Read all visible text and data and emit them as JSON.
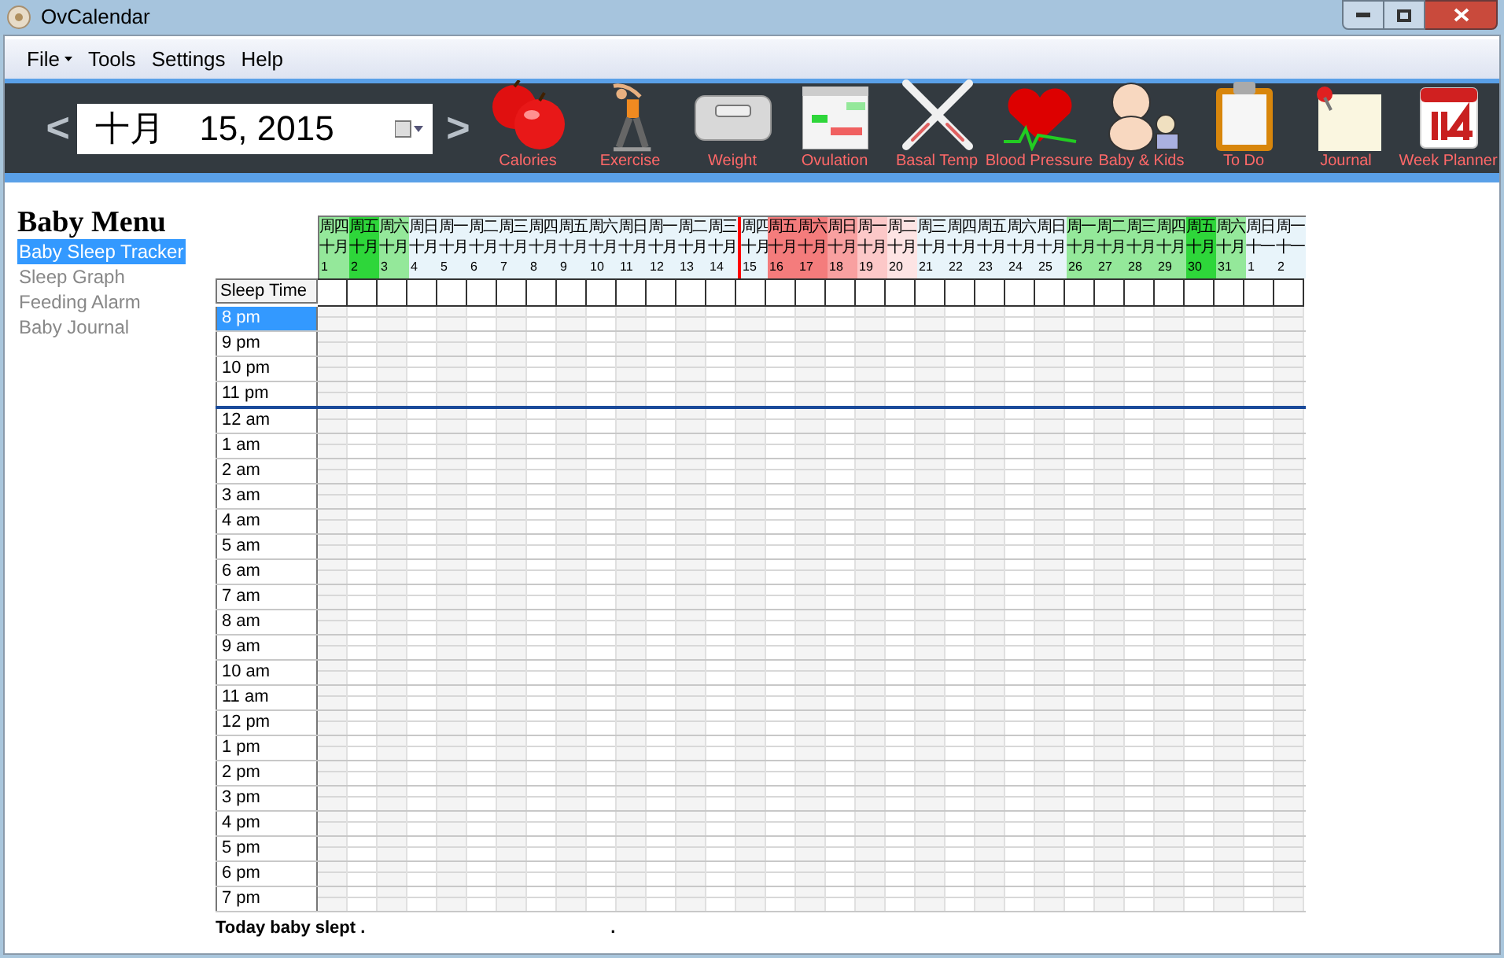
{
  "window": {
    "title": "OvCalendar"
  },
  "menu": [
    {
      "label": "File",
      "has_dropdown": true
    },
    {
      "label": "Tools",
      "has_dropdown": false
    },
    {
      "label": "Settings",
      "has_dropdown": false
    },
    {
      "label": "Help",
      "has_dropdown": false
    }
  ],
  "date_nav": {
    "prev": "<",
    "next": ">",
    "date_value": "十月　15, 2015"
  },
  "toolbar": [
    {
      "label": "Calories"
    },
    {
      "label": "Exercise"
    },
    {
      "label": "Weight"
    },
    {
      "label": "Ovulation"
    },
    {
      "label": "Basal Temp"
    },
    {
      "label": "Blood Pressure"
    },
    {
      "label": "Baby & Kids"
    },
    {
      "label": "To Do"
    },
    {
      "label": "Journal"
    },
    {
      "label": "Week Planner"
    }
  ],
  "sidebar": {
    "title": "Baby Menu",
    "items": [
      {
        "label": "Baby Sleep Tracker",
        "selected": true
      },
      {
        "label": "Sleep Graph",
        "selected": false
      },
      {
        "label": "Feeding Alarm",
        "selected": false
      },
      {
        "label": "Baby Journal",
        "selected": false
      }
    ]
  },
  "tracker": {
    "corner_label": "Sleep Time",
    "days": [
      {
        "weekday": "周四",
        "month": "十月",
        "day": "1",
        "color": "#94e89a",
        "selected": false
      },
      {
        "weekday": "周五",
        "month": "十月",
        "day": "2",
        "color": "#2ed63a",
        "selected": false
      },
      {
        "weekday": "周六",
        "month": "十月",
        "day": "3",
        "color": "#94e89a",
        "selected": false
      },
      {
        "weekday": "周日",
        "month": "十月",
        "day": "4",
        "color": "#e8f4fa",
        "selected": false
      },
      {
        "weekday": "周一",
        "month": "十月",
        "day": "5",
        "color": "#e8f4fa",
        "selected": false
      },
      {
        "weekday": "周二",
        "month": "十月",
        "day": "6",
        "color": "#e8f4fa",
        "selected": false
      },
      {
        "weekday": "周三",
        "month": "十月",
        "day": "7",
        "color": "#e8f4fa",
        "selected": false
      },
      {
        "weekday": "周四",
        "month": "十月",
        "day": "8",
        "color": "#e8f4fa",
        "selected": false
      },
      {
        "weekday": "周五",
        "month": "十月",
        "day": "9",
        "color": "#e8f4fa",
        "selected": false
      },
      {
        "weekday": "周六",
        "month": "十月",
        "day": "10",
        "color": "#e8f4fa",
        "selected": false
      },
      {
        "weekday": "周日",
        "month": "十月",
        "day": "11",
        "color": "#e8f4fa",
        "selected": false
      },
      {
        "weekday": "周一",
        "month": "十月",
        "day": "12",
        "color": "#e8f4fa",
        "selected": false
      },
      {
        "weekday": "周二",
        "month": "十月",
        "day": "13",
        "color": "#e8f4fa",
        "selected": false
      },
      {
        "weekday": "周三",
        "month": "十月",
        "day": "14",
        "color": "#e8f4fa",
        "selected": false
      },
      {
        "weekday": "周四",
        "month": "十月",
        "day": "15",
        "color": "#e8f4fa",
        "selected": true
      },
      {
        "weekday": "周五",
        "month": "十月",
        "day": "16",
        "color": "#f47c7c",
        "selected": false
      },
      {
        "weekday": "周六",
        "month": "十月",
        "day": "17",
        "color": "#f47c7c",
        "selected": false
      },
      {
        "weekday": "周日",
        "month": "十月",
        "day": "18",
        "color": "#f8a0a0",
        "selected": false
      },
      {
        "weekday": "周一",
        "month": "十月",
        "day": "19",
        "color": "#fcc8c8",
        "selected": false
      },
      {
        "weekday": "周二",
        "month": "十月",
        "day": "20",
        "color": "#fde4e4",
        "selected": false
      },
      {
        "weekday": "周三",
        "month": "十月",
        "day": "21",
        "color": "#e8f4fa",
        "selected": false
      },
      {
        "weekday": "周四",
        "month": "十月",
        "day": "22",
        "color": "#e8f4fa",
        "selected": false
      },
      {
        "weekday": "周五",
        "month": "十月",
        "day": "23",
        "color": "#e8f4fa",
        "selected": false
      },
      {
        "weekday": "周六",
        "month": "十月",
        "day": "24",
        "color": "#e8f4fa",
        "selected": false
      },
      {
        "weekday": "周日",
        "month": "十月",
        "day": "25",
        "color": "#e8f4fa",
        "selected": false
      },
      {
        "weekday": "周一",
        "month": "十月",
        "day": "26",
        "color": "#94e89a",
        "selected": false
      },
      {
        "weekday": "周二",
        "month": "十月",
        "day": "27",
        "color": "#94e89a",
        "selected": false
      },
      {
        "weekday": "周三",
        "month": "十月",
        "day": "28",
        "color": "#94e89a",
        "selected": false
      },
      {
        "weekday": "周四",
        "month": "十月",
        "day": "29",
        "color": "#94e89a",
        "selected": false
      },
      {
        "weekday": "周五",
        "month": "十月",
        "day": "30",
        "color": "#2ed63a",
        "selected": false
      },
      {
        "weekday": "周六",
        "month": "十月",
        "day": "31",
        "color": "#94e89a",
        "selected": false
      },
      {
        "weekday": "周日",
        "month": "十一",
        "day": "1",
        "color": "#e8f4fa",
        "selected": false
      },
      {
        "weekday": "周一",
        "month": "十一",
        "day": "2",
        "color": "#e8f4fa",
        "selected": false
      }
    ],
    "hours": [
      {
        "label": "8 pm",
        "selected": true,
        "current": false
      },
      {
        "label": "9 pm",
        "selected": false,
        "current": false
      },
      {
        "label": "10 pm",
        "selected": false,
        "current": false
      },
      {
        "label": "11 pm",
        "selected": false,
        "current": true
      },
      {
        "label": "12 am",
        "selected": false,
        "current": false
      },
      {
        "label": "1 am",
        "selected": false,
        "current": false
      },
      {
        "label": "2 am",
        "selected": false,
        "current": false
      },
      {
        "label": "3 am",
        "selected": false,
        "current": false
      },
      {
        "label": "4 am",
        "selected": false,
        "current": false
      },
      {
        "label": "5 am",
        "selected": false,
        "current": false
      },
      {
        "label": "6 am",
        "selected": false,
        "current": false
      },
      {
        "label": "7 am",
        "selected": false,
        "current": false
      },
      {
        "label": "8 am",
        "selected": false,
        "current": false
      },
      {
        "label": "9 am",
        "selected": false,
        "current": false
      },
      {
        "label": "10 am",
        "selected": false,
        "current": false
      },
      {
        "label": "11 am",
        "selected": false,
        "current": false
      },
      {
        "label": "12 pm",
        "selected": false,
        "current": false
      },
      {
        "label": "1 pm",
        "selected": false,
        "current": false
      },
      {
        "label": "2 pm",
        "selected": false,
        "current": false
      },
      {
        "label": "3 pm",
        "selected": false,
        "current": false
      },
      {
        "label": "4 pm",
        "selected": false,
        "current": false
      },
      {
        "label": "5 pm",
        "selected": false,
        "current": false
      },
      {
        "label": "6 pm",
        "selected": false,
        "current": false
      },
      {
        "label": "7 pm",
        "selected": false,
        "current": false
      }
    ],
    "summary": "Today baby slept .",
    "summary_end": "."
  }
}
